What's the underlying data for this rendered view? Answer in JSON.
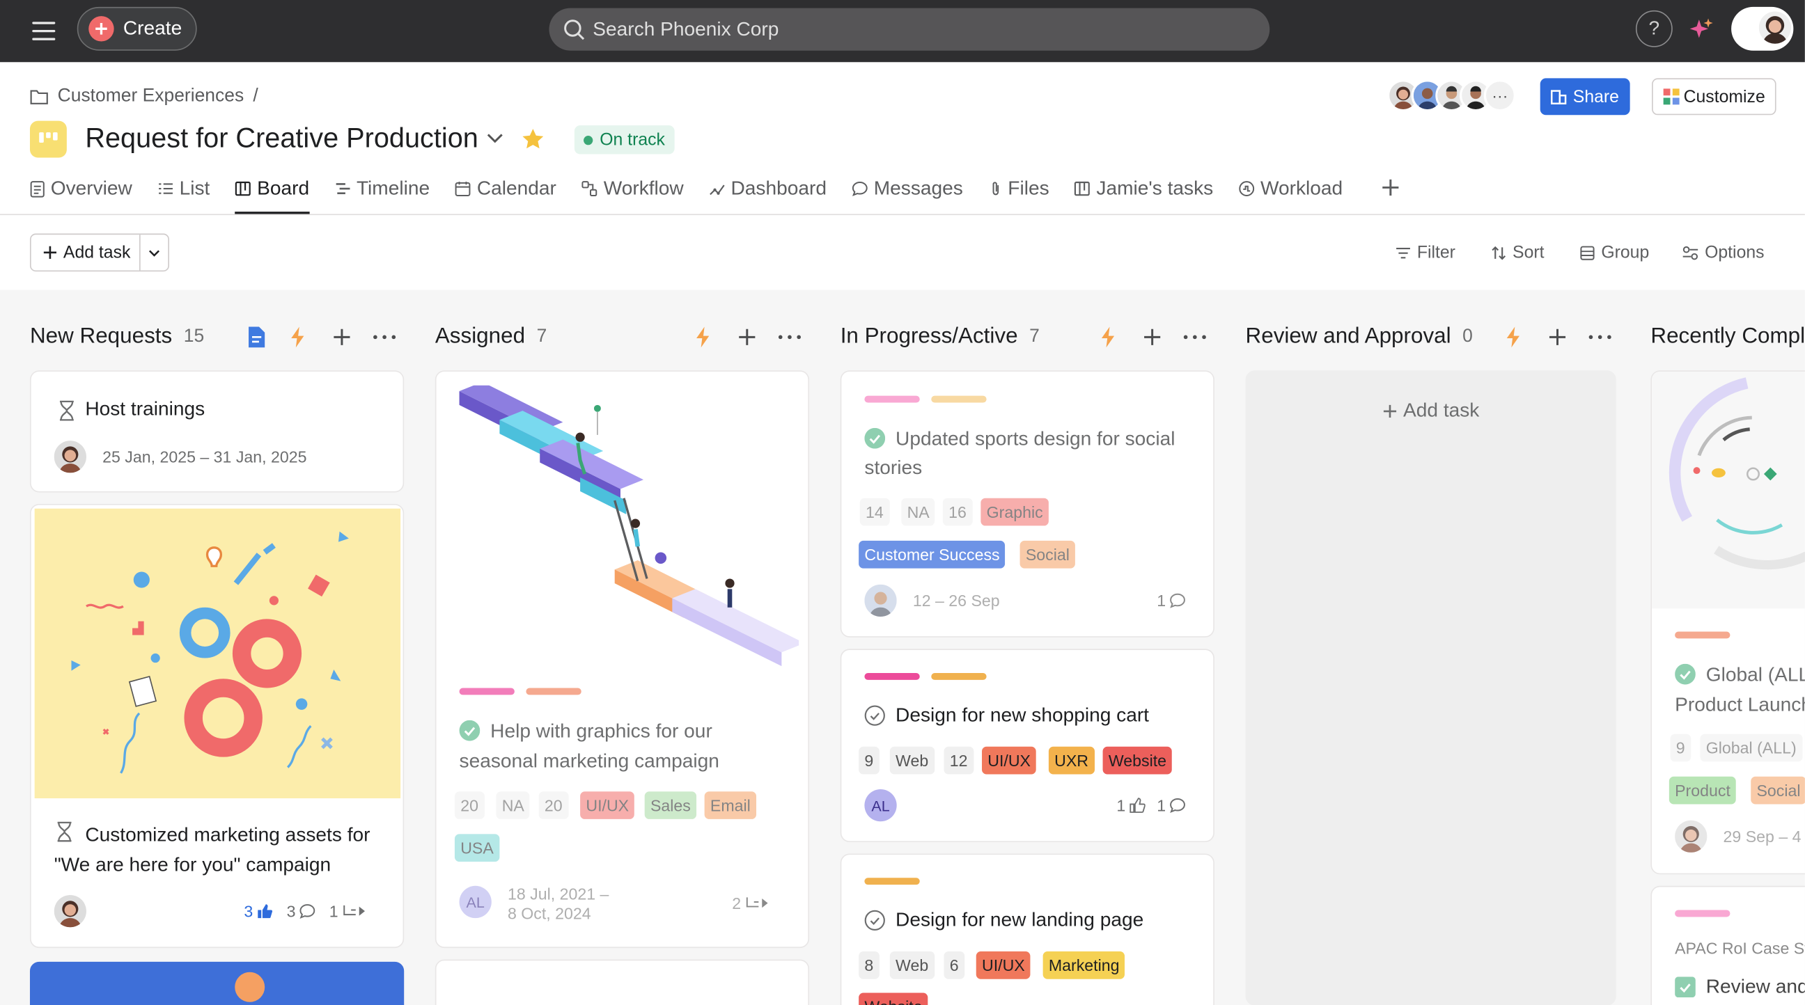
{
  "topbar": {
    "create_label": "Create",
    "search_placeholder": "Search Phoenix Corp",
    "help_label": "?"
  },
  "breadcrumb": {
    "parent": "Customer Experiences",
    "separator": "/"
  },
  "project": {
    "title": "Request for Creative Production",
    "status": "On track",
    "share_label": "Share",
    "customize_label": "Customize"
  },
  "tabs": [
    {
      "label": "Overview",
      "icon": "overview-icon"
    },
    {
      "label": "List",
      "icon": "list-icon"
    },
    {
      "label": "Board",
      "icon": "board-icon",
      "active": true
    },
    {
      "label": "Timeline",
      "icon": "timeline-icon"
    },
    {
      "label": "Calendar",
      "icon": "calendar-icon"
    },
    {
      "label": "Workflow",
      "icon": "workflow-icon"
    },
    {
      "label": "Dashboard",
      "icon": "dashboard-icon"
    },
    {
      "label": "Messages",
      "icon": "messages-icon"
    },
    {
      "label": "Files",
      "icon": "files-icon"
    },
    {
      "label": "Jamie's tasks",
      "icon": "tasks-icon"
    },
    {
      "label": "Workload",
      "icon": "workload-icon"
    }
  ],
  "toolbar": {
    "add_task": "Add task",
    "filter": "Filter",
    "sort": "Sort",
    "group": "Group",
    "options": "Options"
  },
  "columns": [
    {
      "name": "New Requests",
      "count": "15"
    },
    {
      "name": "Assigned",
      "count": "7"
    },
    {
      "name": "In Progress/Active",
      "count": "7"
    },
    {
      "name": "Review and Approval",
      "count": "0",
      "add_task": "Add task"
    },
    {
      "name": "Recently Compl"
    }
  ],
  "cards": {
    "host": {
      "title": "Host trainings",
      "dates": "25 Jan, 2025 – 31 Jan, 2025"
    },
    "marketing": {
      "title_line1": "Customized marketing assets for",
      "title_line2": "\"We are here for you\" campaign",
      "likes": "3",
      "comments": "3",
      "subtasks": "1"
    },
    "graphics": {
      "title_line1": "Help with graphics for our",
      "title_line2": "seasonal marketing campaign",
      "tags": [
        "20",
        "NA",
        "20",
        "UI/UX",
        "Sales",
        "Email",
        "USA"
      ],
      "avatar": "AL",
      "date_line1": "18 Jul, 2021 –",
      "date_line2": "8 Oct, 2024",
      "subtasks": "2"
    },
    "sports": {
      "title_line1": "Updated sports design for social",
      "title_line2": "stories",
      "tags": [
        "14",
        "NA",
        "16",
        "Graphic",
        "Customer Success",
        "Social"
      ],
      "dates": "12 – 26 Sep",
      "comments": "1"
    },
    "cart": {
      "title": "Design for new shopping cart",
      "tags": [
        "9",
        "Web",
        "12",
        "UI/UX",
        "UXR",
        "Website"
      ],
      "avatar": "AL",
      "likes": "1",
      "comments": "1"
    },
    "landing": {
      "title": "Design for new landing page",
      "tags": [
        "8",
        "Web",
        "6",
        "UI/UX",
        "Marketing",
        "Website"
      ]
    },
    "global": {
      "title_line1": "Global (ALL",
      "title_line2": "Product Launch",
      "tags": [
        "9",
        "Global (ALL)",
        "Product",
        "Social"
      ],
      "dates": "29 Sep – 4"
    },
    "apac": {
      "project": "APAC RoI Case St",
      "title": "Review and"
    }
  },
  "colors": {
    "accent": "#2e6bdc",
    "topbar": "#2e2e30",
    "create": "#f06a6a",
    "on_track": "#3aa775"
  }
}
